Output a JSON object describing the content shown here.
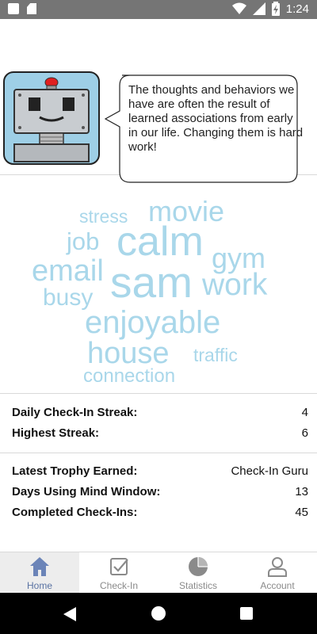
{
  "status_bar": {
    "time": "1:24"
  },
  "robot": {
    "message": "The thoughts and behaviors we have are often the result of learned associations from early in our life. Changing them is hard work!"
  },
  "word_cloud": {
    "color": "#a9d7ea",
    "words": [
      {
        "text": "stress"
      },
      {
        "text": "movie"
      },
      {
        "text": "job"
      },
      {
        "text": "calm"
      },
      {
        "text": "gym"
      },
      {
        "text": "email"
      },
      {
        "text": "sam"
      },
      {
        "text": "work"
      },
      {
        "text": "busy"
      },
      {
        "text": "enjoyable"
      },
      {
        "text": "house"
      },
      {
        "text": "traffic"
      },
      {
        "text": "connection"
      }
    ]
  },
  "stats": {
    "daily_streak": {
      "label": "Daily Check-In Streak:",
      "value": "4"
    },
    "highest_streak": {
      "label": "Highest Streak:",
      "value": "6"
    },
    "latest_trophy": {
      "label": "Latest Trophy Earned:",
      "value": "Check-In Guru"
    },
    "days_using": {
      "label": "Days Using Mind Window:",
      "value": "13"
    },
    "completed": {
      "label": "Completed Check-Ins:",
      "value": "45"
    }
  },
  "bottom_nav": {
    "active_color": "#5a73a3",
    "items": [
      {
        "label": "Home",
        "icon": "home-icon"
      },
      {
        "label": "Check-In",
        "icon": "checkbox-icon"
      },
      {
        "label": "Statistics",
        "icon": "pie-chart-icon"
      },
      {
        "label": "Account",
        "icon": "person-icon"
      }
    ]
  }
}
